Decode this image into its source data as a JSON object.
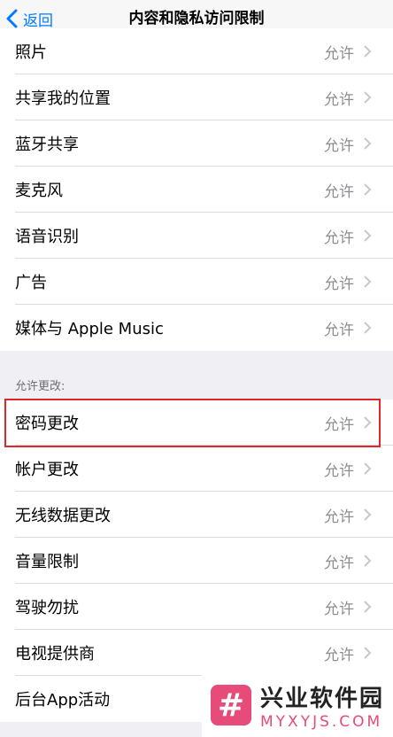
{
  "nav": {
    "back_label": "返回",
    "title": "内容和隐私访问限制"
  },
  "group1": {
    "rows": [
      {
        "label": "照片",
        "value": "允许"
      },
      {
        "label": "共享我的位置",
        "value": "允许"
      },
      {
        "label": "蓝牙共享",
        "value": "允许"
      },
      {
        "label": "麦克风",
        "value": "允许"
      },
      {
        "label": "语音识别",
        "value": "允许"
      },
      {
        "label": "广告",
        "value": "允许"
      },
      {
        "label": "媒体与 Apple Music",
        "value": "允许"
      }
    ]
  },
  "group2": {
    "header": "允许更改:",
    "rows": [
      {
        "label": "密码更改",
        "value": "允许"
      },
      {
        "label": "帐户更改",
        "value": "允许"
      },
      {
        "label": "无线数据更改",
        "value": "允许"
      },
      {
        "label": "音量限制",
        "value": "允许"
      },
      {
        "label": "驾驶勿扰",
        "value": "允许"
      },
      {
        "label": "电视提供商",
        "value": "允许"
      },
      {
        "label": "后台App活动",
        "value": ""
      }
    ]
  },
  "watermark": {
    "logo": "#",
    "title": "兴业软件园",
    "subtitle": "MYXYJS.COM"
  },
  "colors": {
    "accent": "#007aff",
    "highlight": "#e0262c",
    "value_gray": "#8e8e93"
  }
}
